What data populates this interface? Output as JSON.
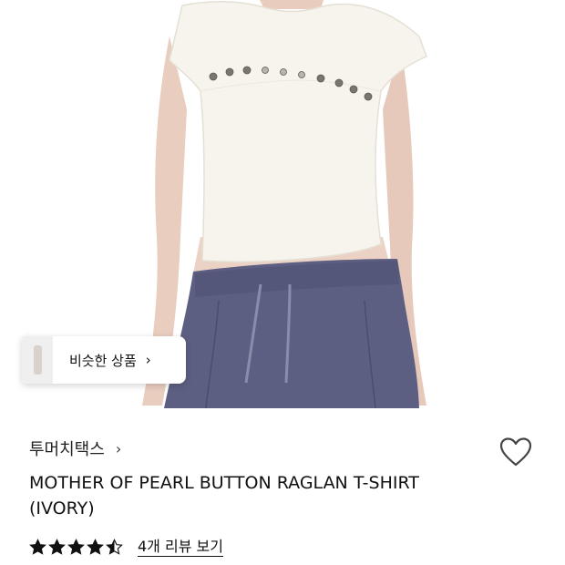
{
  "product_image": {
    "alt_icon": "model-photo-ivory-tshirt"
  },
  "similar": {
    "label": "비슷한 상품",
    "chevron": "›"
  },
  "brand": {
    "name": "투머치택스",
    "chevron": "›"
  },
  "product": {
    "title_line1": "MOTHER OF PEARL BUTTON RAGLAN T-SHIRT",
    "title_line2": "(IVORY)"
  },
  "rating": {
    "stars": 4.5,
    "review_link": "4개 리뷰 보기"
  },
  "colors": {
    "text": "#111111",
    "star": "#111111",
    "heart": "#444444"
  }
}
